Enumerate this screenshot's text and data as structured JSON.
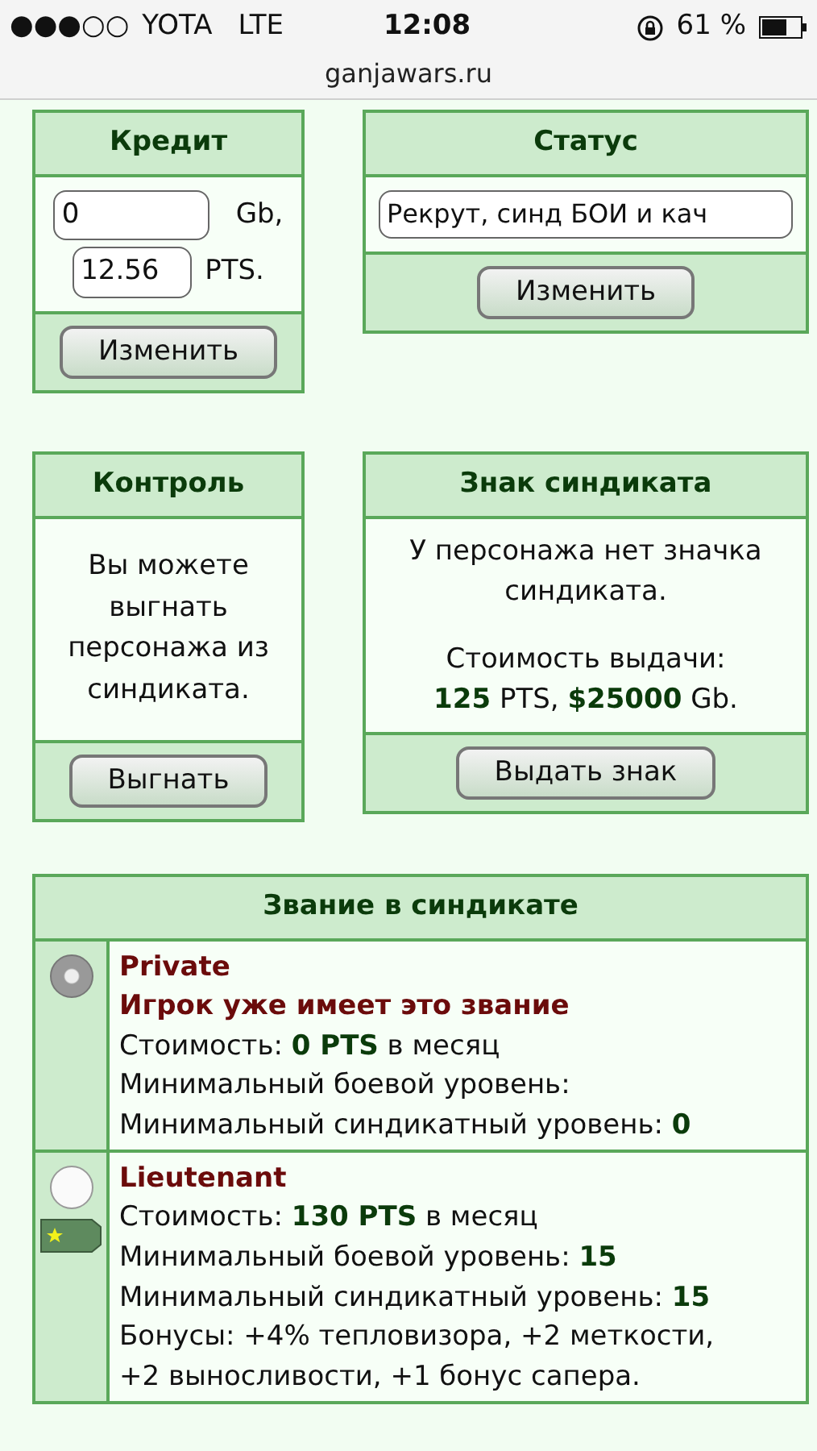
{
  "status_bar": {
    "signal": "●●●○○",
    "carrier": "YOTA",
    "network": "LTE",
    "time": "12:08",
    "battery": "61 %"
  },
  "url": "ganjawars.ru",
  "credit": {
    "title": "Кредит",
    "gb_value": "0",
    "gb_unit": "Gb,",
    "pts_value": "12.56",
    "pts_unit": "PTS.",
    "button": "Изменить"
  },
  "status": {
    "title": "Статус",
    "value": "Рекрут, синд БОИ и кач",
    "button": "Изменить"
  },
  "control": {
    "title": "Контроль",
    "text": "Вы можете выгнать персонажа из синдиката.",
    "button": "Выгнать"
  },
  "sign": {
    "title": "Знак синдиката",
    "text": "У персонажа нет значка синдиката.",
    "cost_label": "Стоимость выдачи:",
    "cost": "**125** PTS, **$25000** Gb.",
    "button": "Выдать знак"
  },
  "ranks": {
    "title": "Звание в синдикате",
    "items": [
      {
        "name": "Private",
        "selected": true,
        "disabled": true,
        "badge": false,
        "note": "Игрок уже имеет это звание",
        "lines": [
          "Стоимость: **0 PTS** в месяц",
          "Минимальный боевой уровень:",
          "Минимальный синдикатный уровень: **0**"
        ]
      },
      {
        "name": "Lieutenant",
        "selected": false,
        "disabled": false,
        "badge": true,
        "lines": [
          "Стоимость: **130 PTS** в месяц",
          "Минимальный боевой уровень: **15**",
          "Минимальный синдикатный уровень: **15**",
          "Бонусы: +4% тепловизора, +2 меткости, +2 выносливости, +1 бонус сапера."
        ]
      }
    ]
  }
}
